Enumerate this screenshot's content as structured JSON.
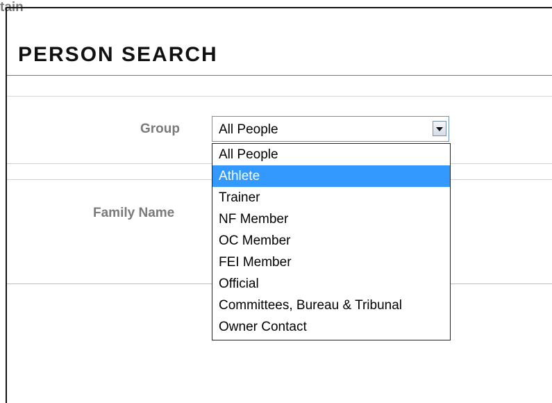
{
  "page": {
    "title": "PERSON SEARCH"
  },
  "form": {
    "group_label": "Group",
    "family_name_label": "Family Name",
    "partial_label": "tain",
    "group_select": {
      "selected_value": "All People",
      "highlighted_option": "Athlete",
      "options": [
        "All People",
        "Athlete",
        "Trainer",
        "NF Member",
        "OC Member",
        "FEI Member",
        "Official",
        "Committees, Bureau & Tribunal",
        "Owner Contact"
      ]
    }
  },
  "colors": {
    "highlight": "#3399ff",
    "label_gray": "#7a7a7a"
  },
  "icons": {
    "dropdown_button": "chevron-down-icon"
  }
}
